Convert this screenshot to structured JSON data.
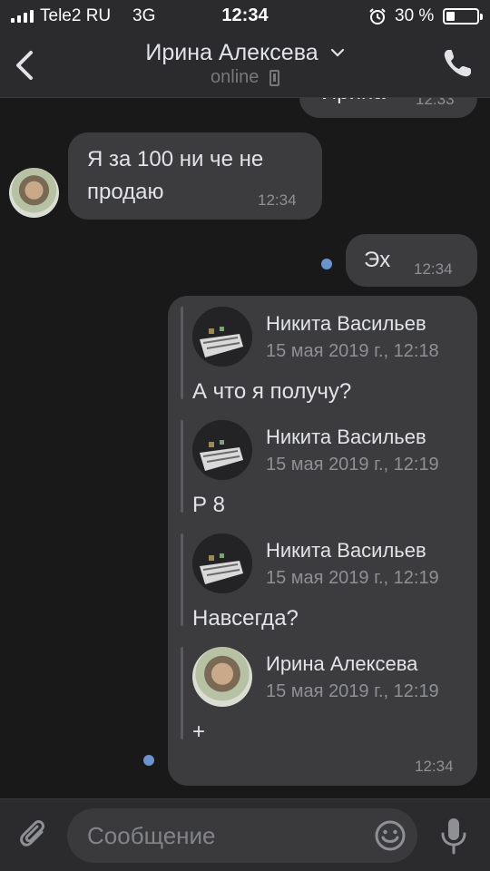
{
  "status_bar": {
    "carrier": "Tele2 RU",
    "network": "3G",
    "time": "12:34",
    "battery_percent": "30 %"
  },
  "header": {
    "name": "Ирина Алексева",
    "status": "online",
    "icons": {
      "back": "chevron-left-icon",
      "dropdown": "chevron-down-icon",
      "device": "mobile-phone-icon",
      "call": "phone-call-icon"
    }
  },
  "messages": [
    {
      "direction": "out",
      "text": "Ирина",
      "time": "12:33",
      "partially_visible": true
    },
    {
      "direction": "in",
      "sender": "Ирина Алексева",
      "text": "Я за 100 ни че не продаю",
      "line1": "Я за 100 ни че не",
      "line2": "продаю",
      "time": "12:34"
    },
    {
      "direction": "out",
      "text": "Эх",
      "time": "12:34",
      "unread": true
    },
    {
      "direction": "out",
      "time": "12:34",
      "unread": true,
      "forwarded": [
        {
          "name": "Никита Васильев",
          "date": "15 мая 2019 г., 12:18",
          "text": "А что я получу?"
        },
        {
          "name": "Никита Васильев",
          "date": "15 мая 2019 г., 12:19",
          "text": "Р 8"
        },
        {
          "name": "Никита Васильев",
          "date": "15 мая 2019 г., 12:19",
          "text": "Навсегда?"
        },
        {
          "name": "Ирина Алексева",
          "date": "15 мая 2019 г., 12:19",
          "text": "+"
        }
      ]
    }
  ],
  "composer": {
    "placeholder": "Сообщение",
    "icons": {
      "attach": "paperclip-icon",
      "emoji": "emoji-smile-icon",
      "voice": "microphone-icon"
    }
  },
  "colors": {
    "background": "#19191a",
    "bar": "#2b2b2d",
    "bubble": "#3c3c3e",
    "text": "#e1e3e6",
    "secondary_text": "#8e9093",
    "unread_dot": "#6b93cc"
  }
}
